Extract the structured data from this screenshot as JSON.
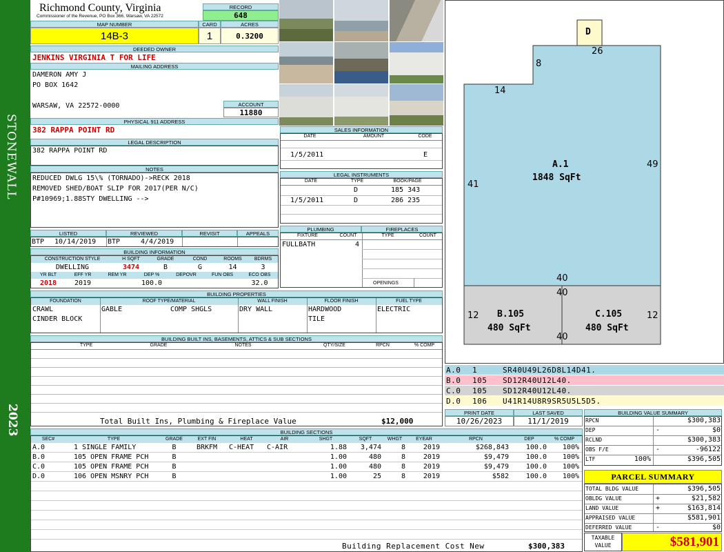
{
  "sidebar": {
    "district": "STONEWALL",
    "year": "2023"
  },
  "header": {
    "county": "Richmond County, Virginia",
    "subline": "Commissioner of the Revenue, PO Box 366, Warsaw, VA 22572",
    "record_label": "RECORD",
    "record": "648",
    "map_label": "MAP NUMBER",
    "map_number": "14B-3",
    "card_label": "CARD",
    "card": "1",
    "acres_label": "ACRES",
    "acres": "0.3200"
  },
  "owner": {
    "deeded_label": "DEEDED OWNER",
    "deeded": "JENKINS VIRGINIA T FOR LIFE",
    "mailing_label": "MAILING ADDRESS",
    "mail1": "DAMERON AMY J",
    "mail2": "PO BOX 1642",
    "mail3": "WARSAW, VA 22572-0000",
    "account_label": "ACCOUNT",
    "account": "11880",
    "physical_label": "PHYSICAL 911 ADDRESS",
    "physical": "382 RAPPA POINT RD",
    "legal_label": "LEGAL DESCRIPTION",
    "legal": "382 RAPPA POINT RD",
    "notes_label": "NOTES",
    "note1": "REDUCED DWLG 15\\% (TORNADO)->RECK 2018",
    "note2": "REMOVED SHED/BOAT SLIP FOR 2017(PER N/C)",
    "note3": "P#10969;1.88STY DWELLING -->"
  },
  "review": {
    "listed_label": "LISTED",
    "listed_by": "BTP",
    "listed_date": "10/14/2019",
    "reviewed_label": "REVIEWED",
    "reviewed_by": "BTP",
    "reviewed_date": "4/4/2019",
    "revisit_label": "REVISIT",
    "appeals_label": "APPEALS"
  },
  "building_info": {
    "title": "BUILDING INFORMATION",
    "h_style": "CONSTRUCTION STYLE",
    "h_sqft": "H SQFT",
    "h_grade": "GRADE",
    "h_cond": "COND",
    "h_rooms": "ROOMS",
    "h_bdrms": "BDRMS",
    "style": "DWELLING",
    "sqft": "3474",
    "grade": "B",
    "cond": "G",
    "rooms": "14",
    "bdrms": "3",
    "h_yrblt": "YR BLT",
    "h_effyr": "EFF YR",
    "h_remyr": "REM YR",
    "h_dep": "DEP %",
    "h_depovr": "DEPOVR",
    "h_funobs": "FUN OBS",
    "h_ecoobs": "ECO OBS",
    "yrblt": "2018",
    "effyr": "2019",
    "remyr": "",
    "dep": "100.0",
    "depovr": "",
    "funobs": "",
    "ecoobs": "32.0"
  },
  "sales": {
    "title": "SALES INFORMATION",
    "h_date": "DATE",
    "h_amount": "AMOUNT",
    "h_code": "CODE",
    "date": "1/5/2011",
    "amount": "",
    "code": "E"
  },
  "legal_inst": {
    "title": "LEGAL INSTRUMENTS",
    "h_date": "DATE",
    "h_type": "TYPE",
    "h_book": "BOOK/PAGE",
    "rows": [
      {
        "date": "",
        "type": "D",
        "book": "185 343"
      },
      {
        "date": "1/5/2011",
        "type": "D",
        "book": "286 235"
      }
    ]
  },
  "plumbing": {
    "title": "PLUMBING",
    "h_fixture": "FIXTURE",
    "h_count": "COUNT",
    "fixture": "FULLBATH",
    "count": "4"
  },
  "fireplaces": {
    "title": "FIREPLACES",
    "h_type": "TYPE",
    "h_count": "COUNT",
    "openings_label": "OPENINGS"
  },
  "properties": {
    "title": "BUILDING PROPERTIES",
    "h_found": "FOUNDATION",
    "h_roof": "ROOF TYPE/MATERIAL",
    "h_wall": "WALL FINISH",
    "h_floor": "FLOOR FINISH",
    "h_fuel": "FUEL TYPE",
    "found1": "CRAWL",
    "found2": "CINDER BLOCK",
    "roof_type": "GABLE",
    "roof_mat": "COMP SHGLS",
    "wall": "DRY WALL",
    "floor1": "HARDWOOD",
    "floor2": "TILE",
    "fuel": "ELECTRIC"
  },
  "builtins": {
    "title": "BUILDING BUILT INS, BASEMENTS, ATTICS & SUB SECTIONS",
    "h_type": "TYPE",
    "h_grade": "GRADE",
    "h_notes": "NOTES",
    "h_qty": "QTY/SIZE",
    "h_rpcn": "RPCN",
    "h_comp": "% COMP",
    "total_label": "Total Built Ins, Plumbing & Fireplace Value",
    "total": "$12,000"
  },
  "dates": {
    "print_label": "PRINT DATE",
    "print": "10/26/2023",
    "saved_label": "LAST SAVED",
    "saved": "11/1/2019"
  },
  "sections": {
    "title": "BUILDING SECTIONS",
    "headers": [
      "SEC#",
      "TYPE",
      "GRADE",
      "EXT FIN",
      "HEAT",
      "AIR",
      "SHGT",
      "SQFT",
      "WHGT",
      "EYEAR",
      "RPCN",
      "DEP",
      "% COMP"
    ],
    "rows": [
      [
        "A.0",
        "1 SINGLE FAMILY",
        "B",
        "BRKFM",
        "C-HEAT",
        "C-AIR",
        "1.88",
        "3,474",
        "8",
        "2019",
        "$268,843",
        "100.0",
        "100%"
      ],
      [
        "B.0",
        "105 OPEN FRAME PCH",
        "B",
        "",
        "",
        "",
        "1.00",
        "480",
        "8",
        "2019",
        "$9,479",
        "100.0",
        "100%"
      ],
      [
        "C.0",
        "105 OPEN FRAME PCH",
        "B",
        "",
        "",
        "",
        "1.00",
        "480",
        "8",
        "2019",
        "$9,479",
        "100.0",
        "100%"
      ],
      [
        "D.0",
        "106 OPEN MSNRY PCH",
        "B",
        "",
        "",
        "",
        "1.00",
        "25",
        "8",
        "2019",
        "$582",
        "100.0",
        "100%"
      ]
    ],
    "replacement_label": "Building Replacement Cost New",
    "replacement": "$300,383"
  },
  "sketch": {
    "d_label": "D",
    "a_label": "A.1",
    "a_area": "1848 SqFt",
    "b_label": "B.105",
    "b_area": "480 SqFt",
    "c_label": "C.105",
    "c_area": "480 SqFt",
    "dims": {
      "top": "26",
      "step": "8",
      "left_top": "14",
      "left": "41",
      "right": "49",
      "a_bottom": "40",
      "bc_top": "40",
      "bc_bottom": "40",
      "bc_left": "12",
      "bc_right": "12"
    },
    "colors": {
      "a": "#add8e6",
      "bc": "#d3d3d3",
      "d": "#fffacd"
    }
  },
  "sketch_codes": [
    {
      "id": "A.0",
      "num": "1",
      "code": "SR40U49L26D8L14D41.",
      "color": "#add8e6"
    },
    {
      "id": "B.0",
      "num": "105",
      "code": "SD12R40U12L40.",
      "color": "#ffc0cb"
    },
    {
      "id": "C.0",
      "num": "105",
      "code": "SD12R40U12L40.",
      "color": "#d3d3d3"
    },
    {
      "id": "D.0",
      "num": "106",
      "code": "U41R14U8R9SR5U5L5D5.",
      "color": "#fffacd"
    }
  ],
  "value_summary": {
    "title": "BUILDING VALUE SUMMARY",
    "rpcn_label": "RPCN",
    "rpcn": "$300,383",
    "dep_label": "DEP",
    "dep_sign": "-",
    "dep": "$0",
    "rclnd_label": "RCLND",
    "rclnd": "$300,383",
    "obs_label": "OBS F/E",
    "obs_sign": "-",
    "obs": "-96122",
    "ltf_label": "LTF",
    "ltf_pct": "100%",
    "ltf": "$396,505"
  },
  "parcel": {
    "title": "PARCEL SUMMARY",
    "bldg_label": "TOTAL BLDG VALUE",
    "bldg": "$396,505",
    "obldg_label": "OBLDG VALUE",
    "obldg_sign": "+",
    "obldg": "$21,582",
    "land_label": "LAND VALUE",
    "land_sign": "+",
    "land": "$163,814",
    "appraised_label": "APPRAISED VALUE",
    "appraised": "$581,901",
    "deferred_label": "DEFERRED VALUE",
    "deferred_sign": "-",
    "deferred": "$0",
    "taxable_label1": "TAXABLE",
    "taxable_label2": "VALUE",
    "taxable": "$581,901"
  }
}
